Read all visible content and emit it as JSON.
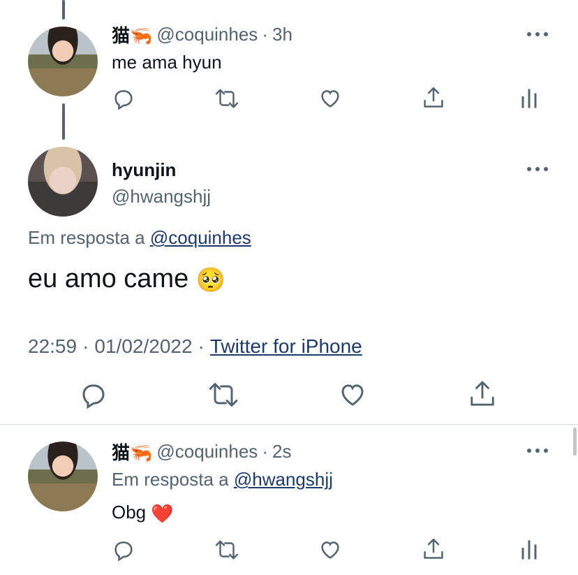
{
  "tweet1": {
    "name": "猫🦐",
    "handle": "@coquinhes",
    "sep": "·",
    "time": "3h",
    "text": "me ama hyun"
  },
  "main": {
    "name": "hyunjin",
    "handle": "@hwangshjj",
    "reply_prefix": "Em resposta a",
    "reply_to": "@coquinhes",
    "text": "eu amo came",
    "emoji": "🥺",
    "time": "22:59",
    "sep1": "·",
    "date": "01/02/2022",
    "sep2": "·",
    "source": "Twitter for iPhone"
  },
  "tweet2": {
    "name": "猫🦐",
    "handle": "@coquinhes",
    "sep": "·",
    "time": "2s",
    "reply_prefix": "Em resposta a",
    "reply_to": "@hwangshjj",
    "text": "Obg",
    "emoji": "❤️"
  },
  "icons": [
    "reply-icon",
    "retweet-icon",
    "like-icon",
    "share-icon",
    "analytics-icon",
    "more-icon"
  ],
  "colors": {
    "text": "#0f1419",
    "secondary": "#536471",
    "link": "#1d3a6b",
    "divider": "#cfd9de"
  }
}
